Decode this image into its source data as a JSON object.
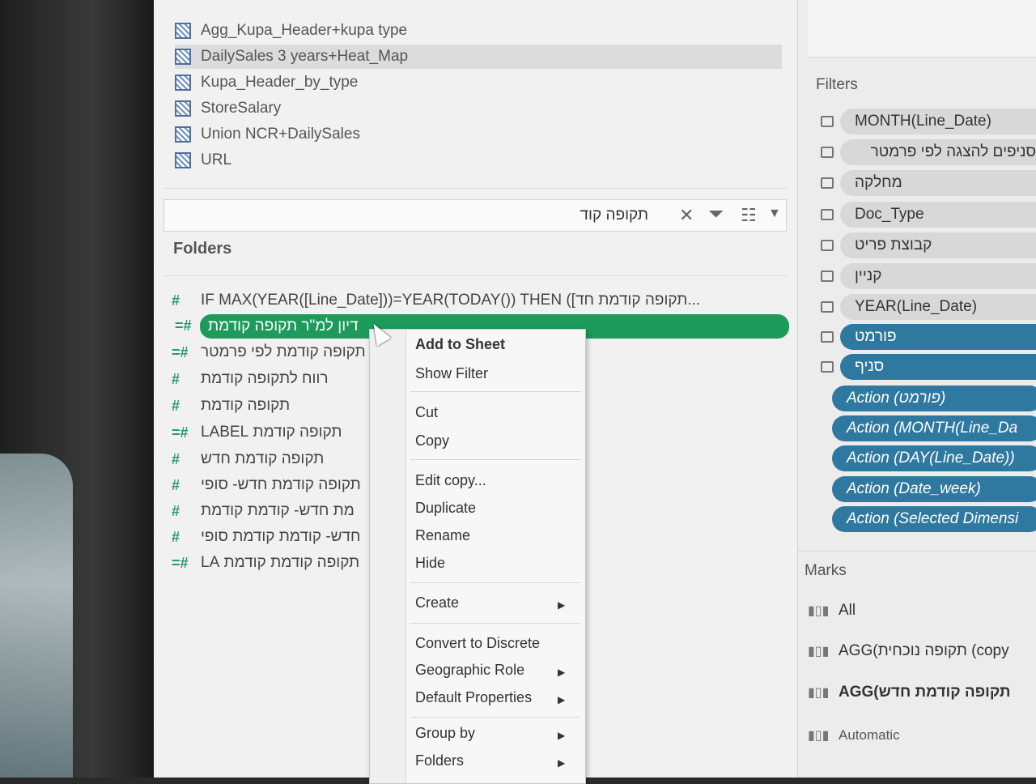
{
  "data_sources": [
    "Agg_Kupa_Header+kupa type",
    "DailySales 3 years+Heat_Map",
    "Kupa_Header_by_type",
    "StoreSalary",
    "Union NCR+DailySales",
    "URL"
  ],
  "search": {
    "value": "תקופה קוד"
  },
  "folders_title": "Folders",
  "fields": [
    "IF MAX(YEAR([Line_Date]))=YEAR(TODAY()) THEN ([תקופה קודמת חד...",
    "דיון למ\"ר תקופה קודמת",
    "תקופה קודמת לפי פרמטר",
    "רווח לתקופה קודמת",
    "תקופה קודמת",
    "תקופה קודמת LABEL",
    "תקופה קודמת חדש",
    "תקופה קודמת חדש- סופי",
    "מת חדש- קודמת קודמת",
    "חדש- קודמת קודמת סופי",
    "תקופה קודמת קודמת LA"
  ],
  "context_menu": {
    "items": [
      "Add to Sheet",
      "Show Filter",
      "Cut",
      "Copy",
      "Edit copy...",
      "Duplicate",
      "Rename",
      "Hide",
      "Create",
      "Convert to Discrete",
      "Geographic Role",
      "Default Properties",
      "Group by",
      "Folders"
    ]
  },
  "filters_title": "Filters",
  "filters": [
    "MONTH(Line_Date)",
    "סניפים להצגה לפי פרמטר",
    "מחלקה",
    "Doc_Type",
    "קבוצת פריט",
    "קניין",
    "YEAR(Line_Date)",
    "פורמט",
    "סניף",
    "Action (פורמט)",
    "Action (MONTH(Line_Da",
    "Action (DAY(Line_Date))",
    "Action (Date_week)",
    "Action (Selected Dimensi"
  ],
  "marks_title": "Marks",
  "marks": [
    "All",
    "AGG(תקופה נוכחית (copy",
    "AGG(תקופה קודמת חדש",
    "Automatic"
  ],
  "colors": {
    "selected_green": "#1e9a5c",
    "filter_blue": "#2f78a0"
  }
}
